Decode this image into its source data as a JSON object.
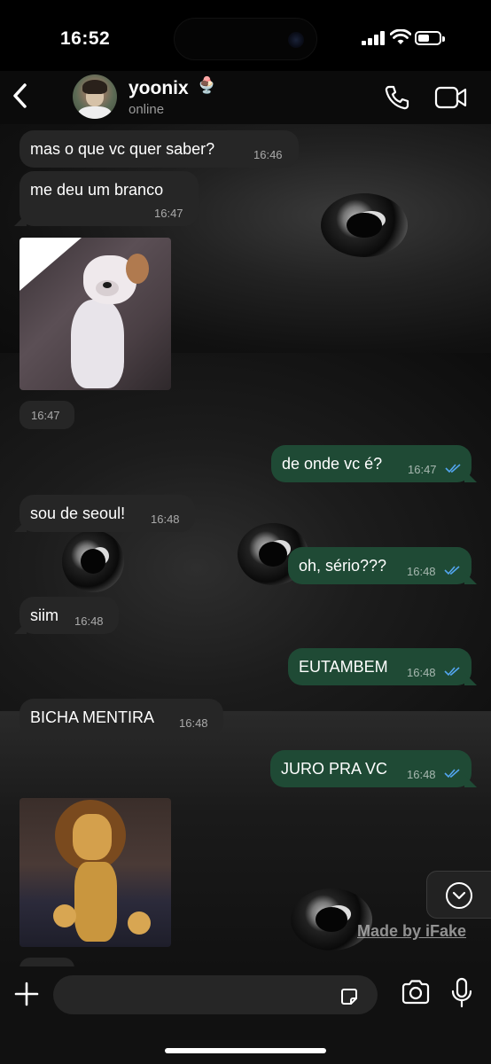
{
  "status_bar": {
    "time": "16:52"
  },
  "header": {
    "contact_name": "yoonix",
    "contact_emoji": "🍨",
    "presence": "online"
  },
  "messages": [
    {
      "side": "in",
      "text": "mas o que vc quer saber?",
      "time": "16:46"
    },
    {
      "side": "in",
      "text": "me deu um branco",
      "time": "16:47"
    },
    {
      "side": "in",
      "type": "image",
      "image": "white-dog-meme",
      "time": "16:47"
    },
    {
      "side": "out",
      "text": "de onde vc é?",
      "time": "16:47",
      "read": true
    },
    {
      "side": "in",
      "text": "sou de seoul!",
      "time": "16:48"
    },
    {
      "side": "out",
      "text": "oh, sério???",
      "time": "16:48",
      "read": true
    },
    {
      "side": "in",
      "text": "siim",
      "time": "16:48"
    },
    {
      "side": "out",
      "text": "EUTAMBEM",
      "time": "16:48",
      "read": true
    },
    {
      "side": "in",
      "text": "BICHA MENTIRA",
      "time": "16:48"
    },
    {
      "side": "out",
      "text": "JURO PRA VC",
      "time": "16:48",
      "read": true
    },
    {
      "side": "in",
      "type": "image",
      "image": "lion-cartoon-meme"
    }
  ],
  "watermark": "Made by iFake",
  "composer": {
    "placeholder": "",
    "value": ""
  },
  "icons": {
    "back": "chevron-left-icon",
    "call": "phone-icon",
    "video": "video-camera-icon",
    "plus": "plus-icon",
    "sticker": "sticker-icon",
    "camera": "camera-icon",
    "mic": "microphone-icon",
    "scroll": "chevron-down-icon"
  },
  "colors": {
    "incoming_bubble": "#262626",
    "outgoing_bubble": "#1f4a35",
    "read_ticks": "#53a6f0"
  }
}
